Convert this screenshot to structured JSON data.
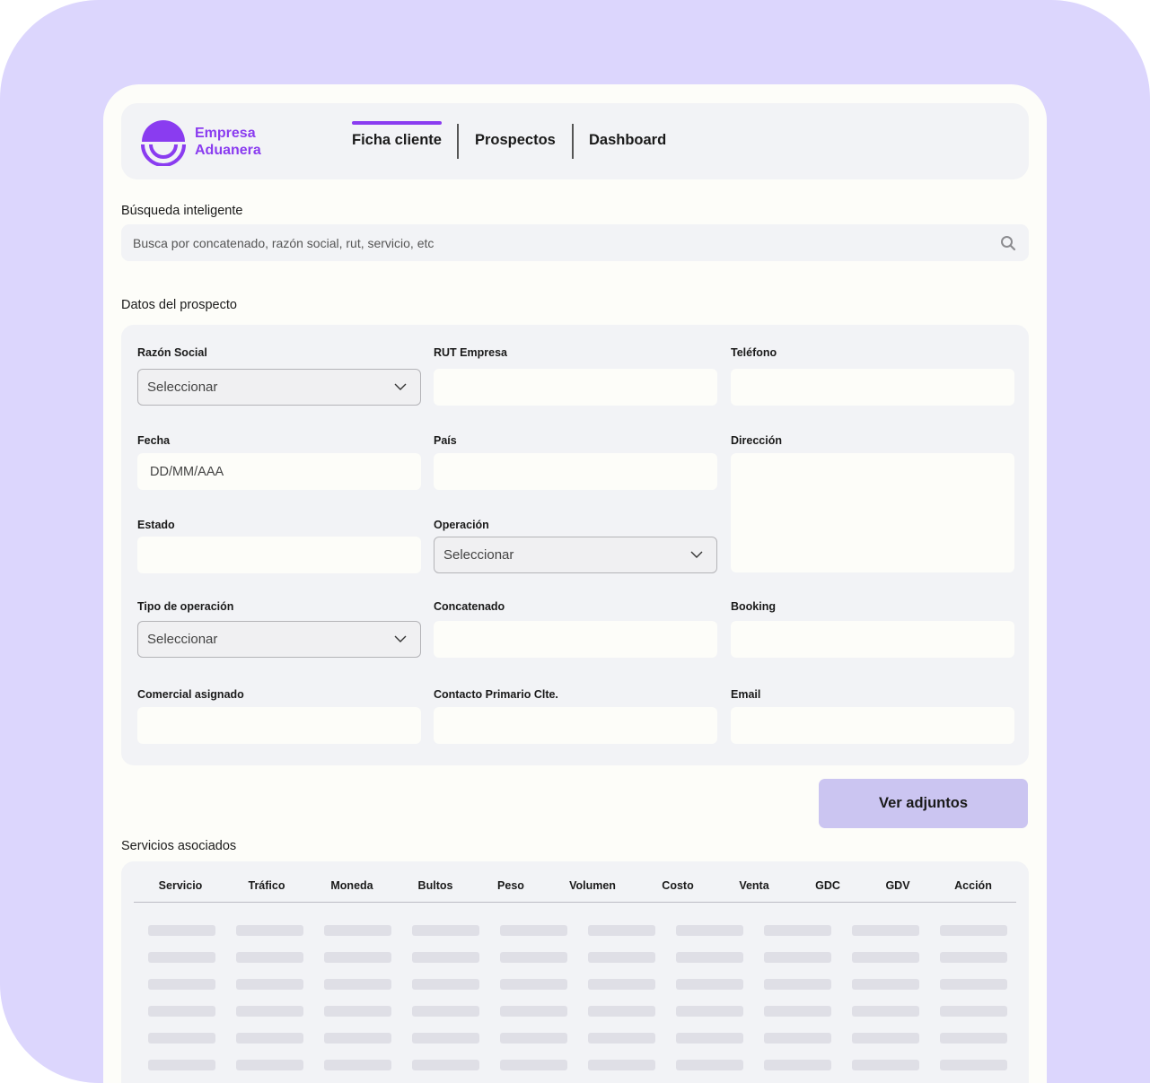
{
  "brand": {
    "name_line1": "Empresa",
    "name_line2": "Aduanera",
    "color": "#8a3cf0"
  },
  "nav": {
    "tabs": [
      {
        "label": "Ficha cliente",
        "active": true
      },
      {
        "label": "Prospectos",
        "active": false
      },
      {
        "label": "Dashboard",
        "active": false
      }
    ]
  },
  "search": {
    "label": "Búsqueda inteligente",
    "placeholder": "Busca por concatenado, razón social, rut, servicio, etc",
    "icon": "search-icon"
  },
  "prospect": {
    "title": "Datos del prospecto",
    "fields": {
      "razon_social": {
        "label": "Razón Social",
        "value": "Seleccionar"
      },
      "rut_empresa": {
        "label": "RUT Empresa",
        "value": ""
      },
      "telefono": {
        "label": "Teléfono",
        "value": ""
      },
      "fecha": {
        "label": "Fecha",
        "placeholder": "DD/MM/AAA"
      },
      "pais": {
        "label": "País",
        "value": ""
      },
      "direccion": {
        "label": "Dirección",
        "value": ""
      },
      "estado": {
        "label": "Estado",
        "value": ""
      },
      "operacion": {
        "label": "Operación",
        "value": "Seleccionar"
      },
      "tipo_operacion": {
        "label": "Tipo de operación",
        "value": "Seleccionar"
      },
      "concatenado": {
        "label": "Concatenado",
        "value": ""
      },
      "booking": {
        "label": "Booking",
        "value": ""
      },
      "comercial": {
        "label": "Comercial asignado",
        "value": ""
      },
      "contacto": {
        "label": "Contacto Primario Clte.",
        "value": ""
      },
      "email": {
        "label": "Email",
        "value": ""
      }
    }
  },
  "attachments_button": "Ver adjuntos",
  "services": {
    "title": "Servicios asociados",
    "columns": [
      "Servicio",
      "Tráfico",
      "Moneda",
      "Bultos",
      "Peso",
      "Volumen",
      "Costo",
      "Venta",
      "GDC",
      "GDV",
      "Acción"
    ],
    "placeholder_rows": 6
  }
}
